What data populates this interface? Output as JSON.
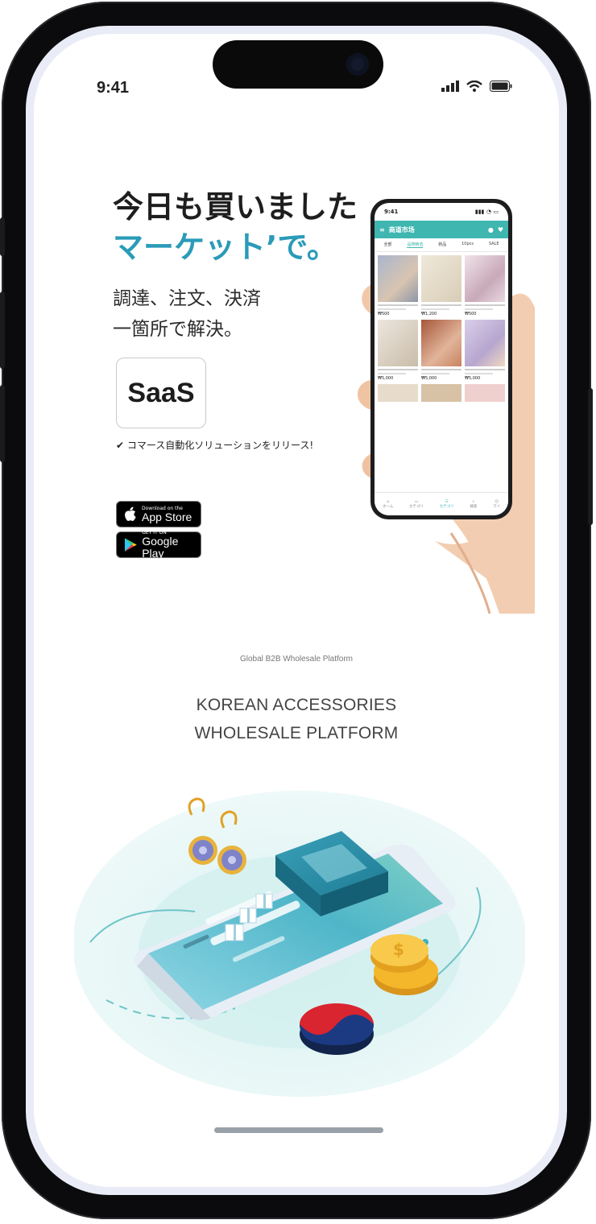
{
  "status_bar": {
    "time": "9:41"
  },
  "hero": {
    "headline_line1": "今日も買いました",
    "headline_line2": "マーケット’で。",
    "sub_line1": "調達、注文、決済",
    "sub_line2": "一箇所で解決。",
    "badge_label": "SaaS",
    "release_note": "✔ コマース自動化ソリューションをリリース!"
  },
  "store_buttons": {
    "app_store_small": "Download on the",
    "app_store_big": "App Store",
    "google_play_small": "GET IT ON",
    "google_play_big": "Google Play"
  },
  "section": {
    "tagline": "Global B2B Wholesale Platform",
    "title_line1": "KOREAN ACCESSORIES",
    "title_line2": "WHOLESALE PLATFORM"
  },
  "mini_app": {
    "time": "9:41",
    "brand": "商道市场",
    "tabs": [
      "全部",
      "品牌精选",
      "新品",
      "10pcs",
      "SALE"
    ],
    "prices": [
      "₩500",
      "₩1,200",
      "₩500",
      "₩5,000",
      "₩5,000",
      "₩5,000"
    ],
    "nav": [
      "ホーム",
      "カテゴリ",
      "カテゴリ",
      "検索",
      "マイ"
    ]
  },
  "colors": {
    "accent": "#2a9bb8",
    "teal": "#3fb6b0",
    "phone_body": "#0b0b0d"
  }
}
